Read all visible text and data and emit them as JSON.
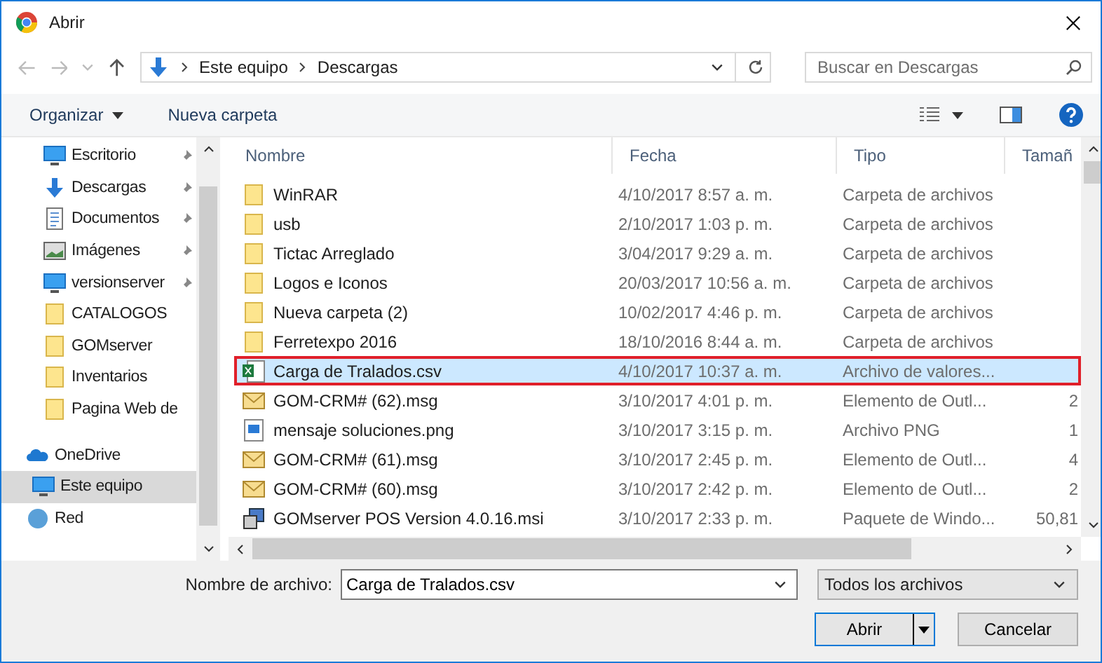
{
  "window": {
    "title": "Abrir"
  },
  "address": {
    "path": [
      "Este equipo",
      "Descargas"
    ]
  },
  "search": {
    "placeholder": "Buscar en Descargas"
  },
  "toolbar": {
    "organize": "Organizar",
    "new_folder": "Nueva carpeta"
  },
  "sidebar": {
    "items": [
      {
        "label": "Escritorio",
        "kind": "desktop",
        "pinned": true,
        "selected": false
      },
      {
        "label": "Descargas",
        "kind": "download",
        "pinned": true,
        "selected": false
      },
      {
        "label": "Documentos",
        "kind": "document",
        "pinned": true,
        "selected": false
      },
      {
        "label": "Imágenes",
        "kind": "image",
        "pinned": true,
        "selected": false
      },
      {
        "label": "versionserver",
        "kind": "desktop",
        "pinned": true,
        "selected": false
      },
      {
        "label": "CATALOGOS",
        "kind": "folder",
        "pinned": false,
        "selected": false
      },
      {
        "label": "GOMserver",
        "kind": "folder",
        "pinned": false,
        "selected": false
      },
      {
        "label": "Inventarios",
        "kind": "folder",
        "pinned": false,
        "selected": false
      },
      {
        "label": "Pagina Web de",
        "kind": "folder",
        "pinned": false,
        "selected": false
      },
      {
        "label": "OneDrive",
        "kind": "cloud",
        "pinned": false,
        "selected": false
      },
      {
        "label": "Este equipo",
        "kind": "computer",
        "pinned": false,
        "selected": true
      },
      {
        "label": "Red",
        "kind": "network",
        "pinned": false,
        "selected": false
      }
    ]
  },
  "table": {
    "columns": [
      "Nombre",
      "Fecha",
      "Tipo",
      "Tamañ"
    ],
    "rows": [
      {
        "kind": "folder",
        "name": "WinRAR",
        "date": "4/10/2017 8:57 a. m.",
        "type": "Carpeta de archivos",
        "size": "",
        "selected": false
      },
      {
        "kind": "folder",
        "name": "usb",
        "date": "2/10/2017 1:03 p. m.",
        "type": "Carpeta de archivos",
        "size": "",
        "selected": false
      },
      {
        "kind": "folder",
        "name": "Tictac Arreglado",
        "date": "3/04/2017 9:29 a. m.",
        "type": "Carpeta de archivos",
        "size": "",
        "selected": false
      },
      {
        "kind": "folder",
        "name": "Logos e Iconos",
        "date": "20/03/2017 10:56 a. m.",
        "type": "Carpeta de archivos",
        "size": "",
        "selected": false
      },
      {
        "kind": "folder",
        "name": "Nueva carpeta (2)",
        "date": "10/02/2017 4:46 p. m.",
        "type": "Carpeta de archivos",
        "size": "",
        "selected": false
      },
      {
        "kind": "folder",
        "name": "Ferretexpo 2016",
        "date": "18/10/2016 8:44 a. m.",
        "type": "Carpeta de archivos",
        "size": "",
        "selected": false
      },
      {
        "kind": "csv",
        "name": "Carga de Tralados.csv",
        "date": "4/10/2017 10:37 a. m.",
        "type": "Archivo de valores...",
        "size": "",
        "selected": true
      },
      {
        "kind": "mail",
        "name": "GOM-CRM# (62).msg",
        "date": "3/10/2017 4:01 p. m.",
        "type": "Elemento de Outl...",
        "size": "2",
        "selected": false
      },
      {
        "kind": "image",
        "name": "mensaje soluciones.png",
        "date": "3/10/2017 3:15 p. m.",
        "type": "Archivo PNG",
        "size": "1",
        "selected": false
      },
      {
        "kind": "mail",
        "name": "GOM-CRM# (61).msg",
        "date": "3/10/2017 2:45 p. m.",
        "type": "Elemento de Outl...",
        "size": "4",
        "selected": false
      },
      {
        "kind": "mail",
        "name": "GOM-CRM# (60).msg",
        "date": "3/10/2017 2:42 p. m.",
        "type": "Elemento de Outl...",
        "size": "2",
        "selected": false
      },
      {
        "kind": "installer",
        "name": "GOMserver POS Version 4.0.16.msi",
        "date": "3/10/2017 2:33 p. m.",
        "type": "Paquete de Windo...",
        "size": "50,81",
        "selected": false
      }
    ]
  },
  "filename": {
    "label": "Nombre de archivo:",
    "value": "Carga de Tralados.csv"
  },
  "filter": {
    "value": "Todos los archivos"
  },
  "buttons": {
    "open": "Abrir",
    "cancel": "Cancelar"
  }
}
